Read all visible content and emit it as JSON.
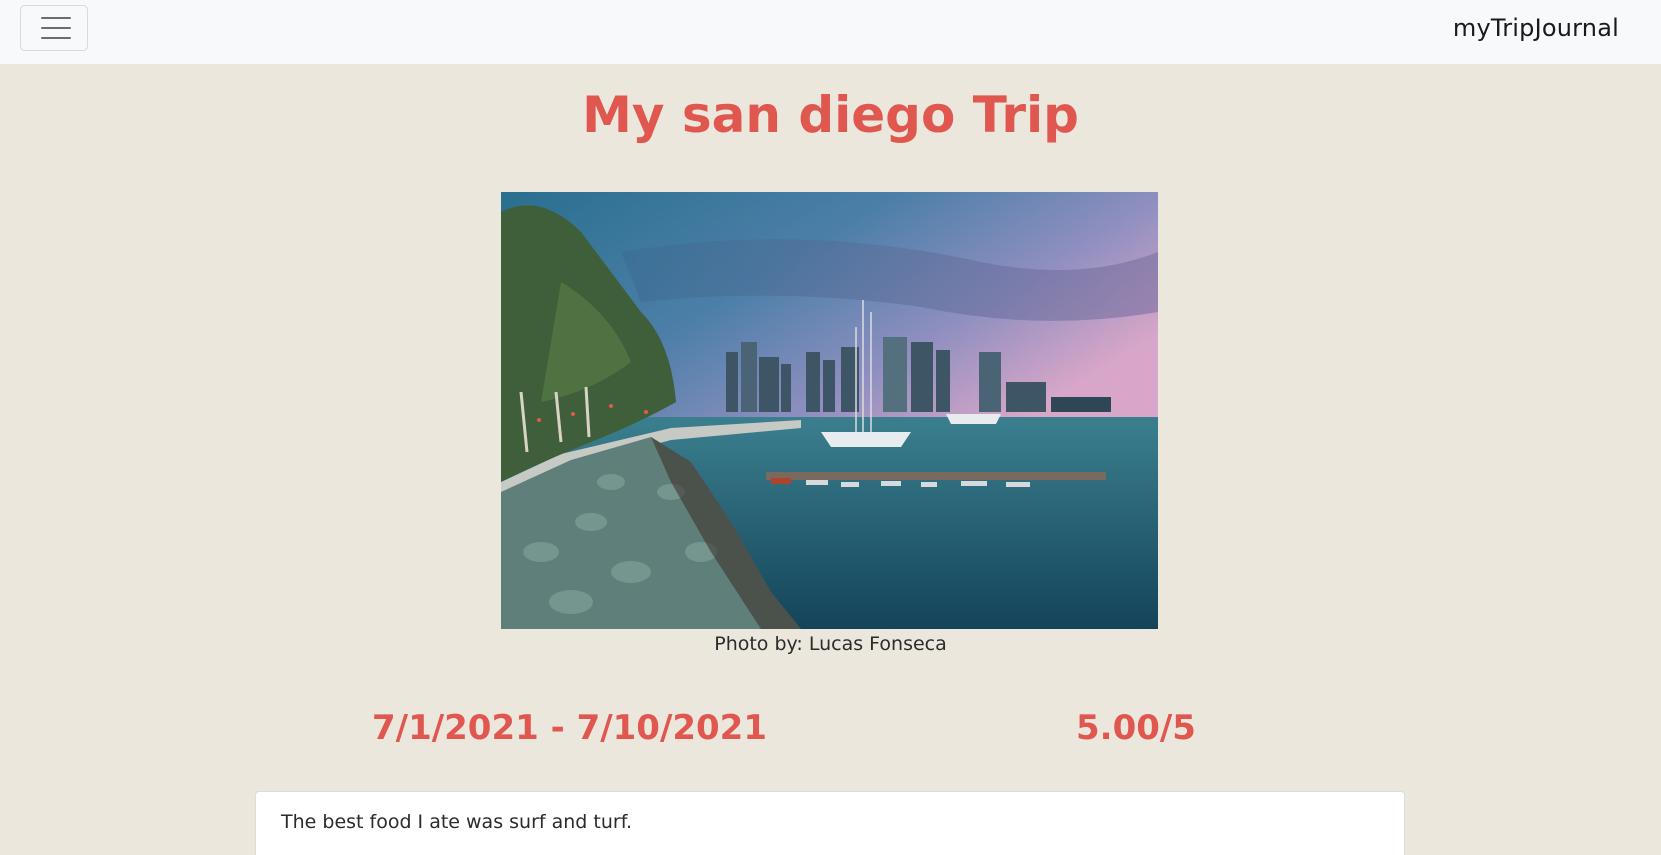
{
  "navbar": {
    "brand": "myTripJournal",
    "toggle_icon": "hamburger-menu-icon"
  },
  "trip": {
    "title": "My san diego Trip",
    "photo_alt": "San Diego harbor skyline at dusk",
    "photo_credit": "Photo by: Lucas Fonseca",
    "dates": "7/1/2021 - 7/10/2021",
    "rating": "5.00/5",
    "notes": [
      "The best food I ate was surf and turf."
    ]
  },
  "colors": {
    "accent": "#e0574f",
    "page_bg": "#ebe7dc",
    "navbar_bg": "#f8f9fa"
  }
}
